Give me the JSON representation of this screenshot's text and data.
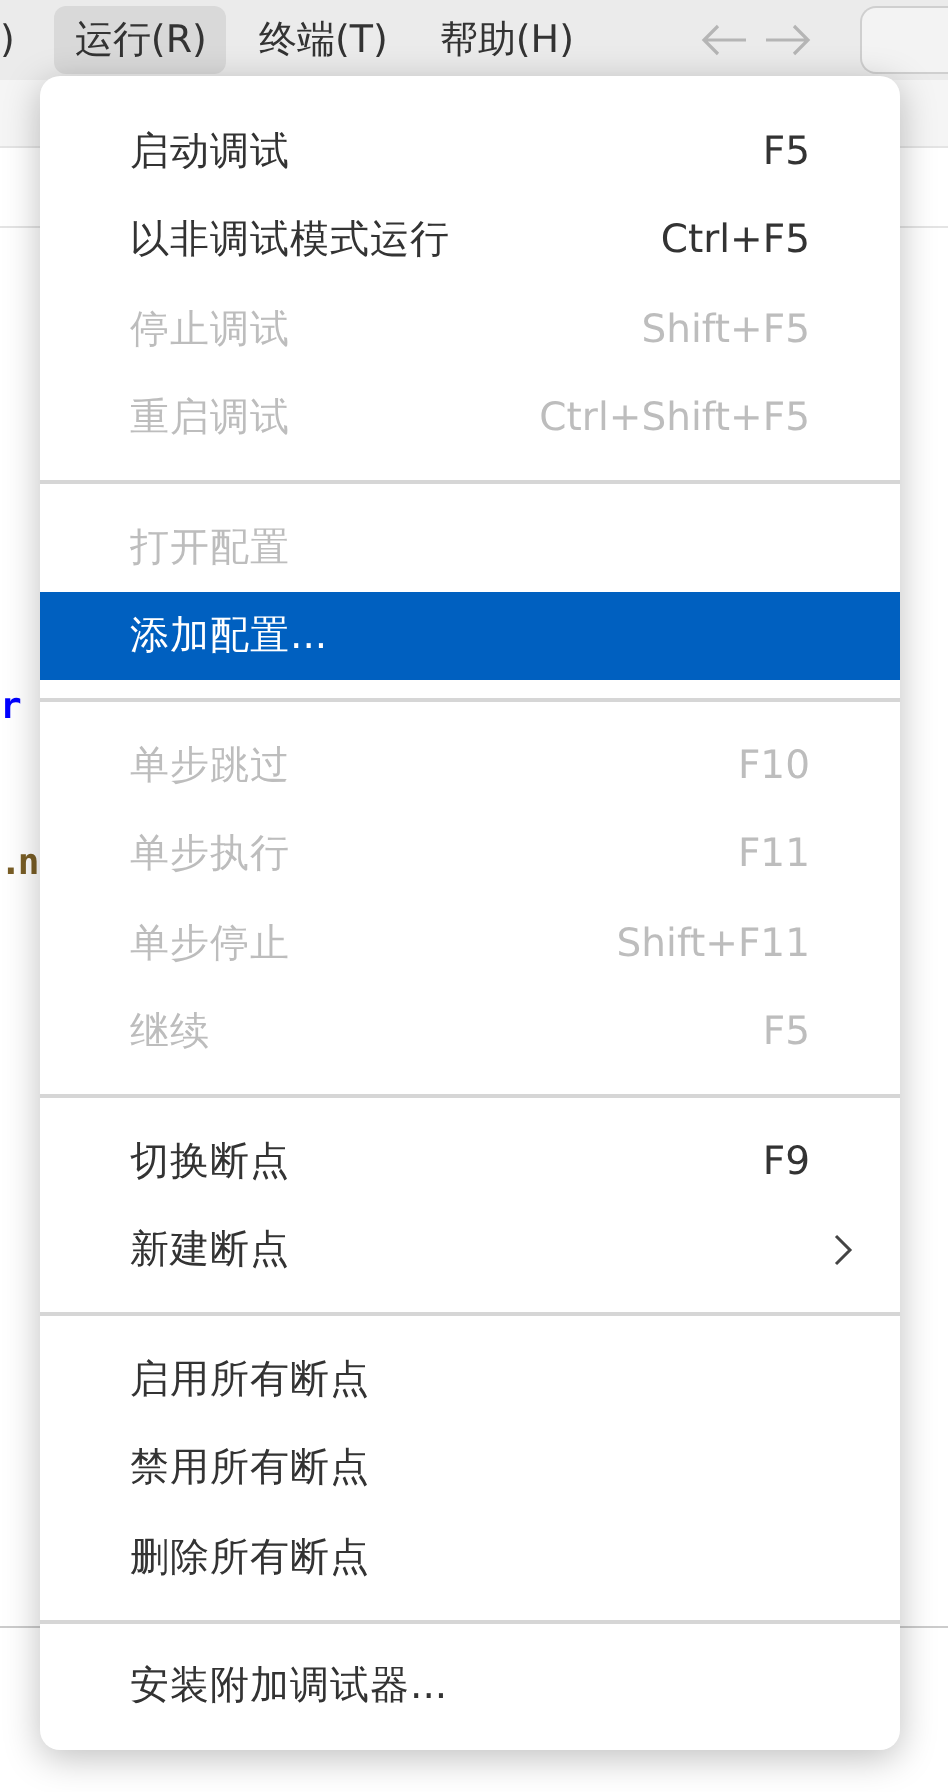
{
  "menu_bar": [
    {
      "label": ")",
      "selected": false
    },
    {
      "label": "运行(R)",
      "selected": true
    },
    {
      "label": "终端(T)",
      "selected": false
    },
    {
      "label": "帮助(H)",
      "selected": false
    }
  ],
  "editor": {
    "code_fragments": [
      {
        "text": "r",
        "color": "#0000ff"
      },
      {
        "text": ".n",
        "color": "#795e26"
      }
    ]
  },
  "menu": {
    "groups": [
      [
        {
          "label": "启动调试",
          "shortcut": "F5",
          "disabled": false,
          "selected": false,
          "submenu": false
        },
        {
          "label": "以非调试模式运行",
          "shortcut": "Ctrl+F5",
          "disabled": false,
          "selected": false,
          "submenu": false
        },
        {
          "label": "停止调试",
          "shortcut": "Shift+F5",
          "disabled": true,
          "selected": false,
          "submenu": false
        },
        {
          "label": "重启调试",
          "shortcut": "Ctrl+Shift+F5",
          "disabled": true,
          "selected": false,
          "submenu": false
        }
      ],
      [
        {
          "label": "打开配置",
          "disabled": true,
          "selected": false,
          "submenu": false
        },
        {
          "label": "添加配置...",
          "disabled": false,
          "selected": true,
          "submenu": false
        }
      ],
      [
        {
          "label": "单步跳过",
          "shortcut": "F10",
          "disabled": true,
          "selected": false,
          "submenu": false
        },
        {
          "label": "单步执行",
          "shortcut": "F11",
          "disabled": true,
          "selected": false,
          "submenu": false
        },
        {
          "label": "单步停止",
          "shortcut": "Shift+F11",
          "disabled": true,
          "selected": false,
          "submenu": false
        },
        {
          "label": "继续",
          "shortcut": "F5",
          "disabled": true,
          "selected": false,
          "submenu": false
        }
      ],
      [
        {
          "label": "切换断点",
          "shortcut": "F9",
          "disabled": false,
          "selected": false,
          "submenu": false
        },
        {
          "label": "新建断点",
          "disabled": false,
          "selected": false,
          "submenu": true
        }
      ],
      [
        {
          "label": "启用所有断点",
          "disabled": false,
          "selected": false,
          "submenu": false
        },
        {
          "label": "禁用所有断点",
          "disabled": false,
          "selected": false,
          "submenu": false
        },
        {
          "label": "删除所有断点",
          "disabled": false,
          "selected": false,
          "submenu": false
        }
      ],
      [
        {
          "label": "安装附加调试器...",
          "disabled": false,
          "selected": false,
          "submenu": false
        }
      ]
    ]
  }
}
